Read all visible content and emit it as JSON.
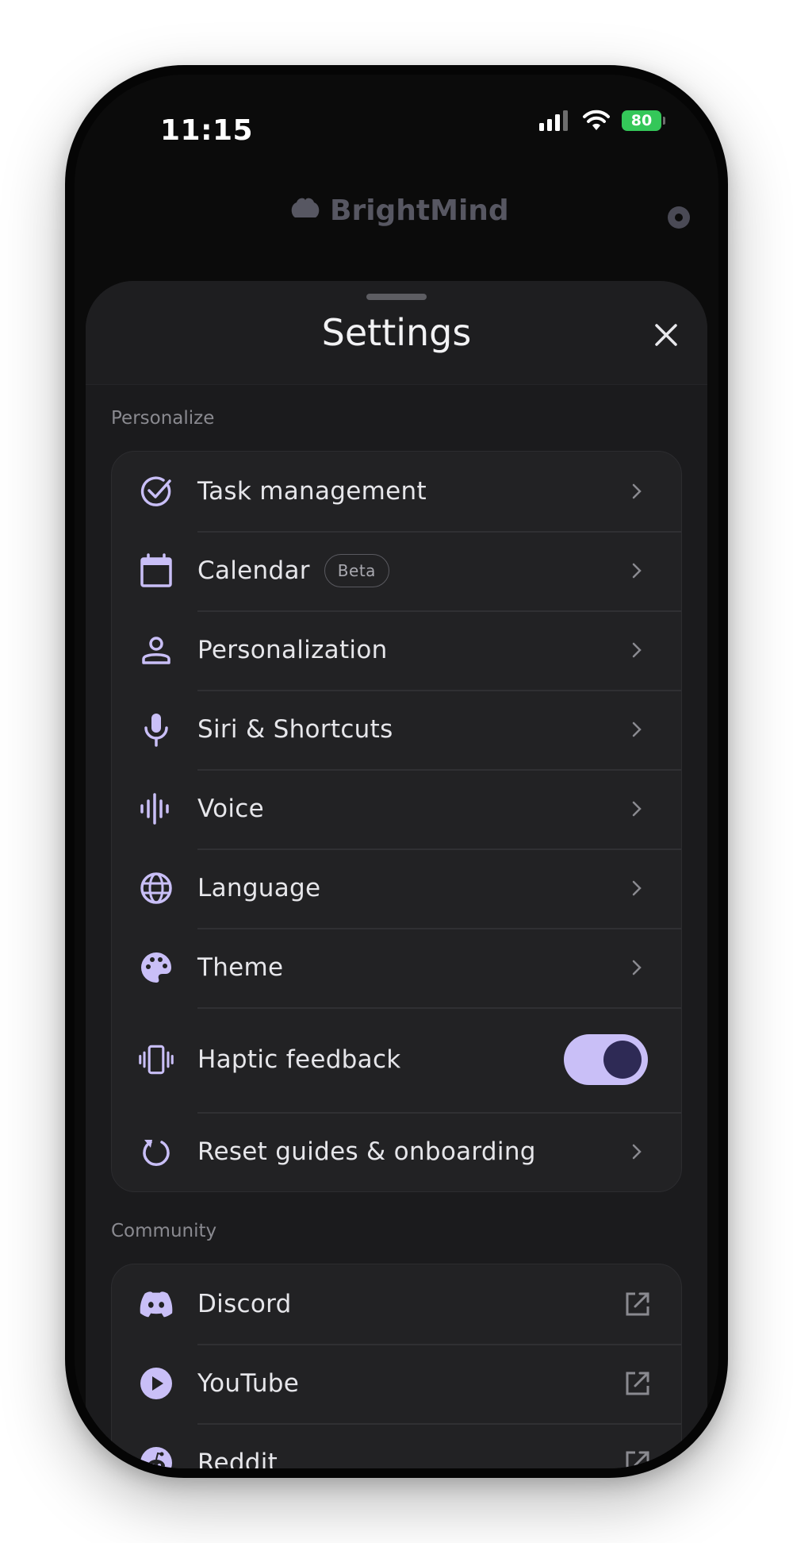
{
  "status_bar": {
    "time": "11:15",
    "battery_level": "80"
  },
  "behind": {
    "brand": "BrightMind"
  },
  "sheet": {
    "title": "Settings"
  },
  "accent_color": "#c9bff7",
  "personalize": {
    "label": "Personalize",
    "items": [
      {
        "label": "Task management",
        "icon": "check-circle-icon"
      },
      {
        "label": "Calendar",
        "badge": "Beta",
        "icon": "calendar-icon"
      },
      {
        "label": "Personalization",
        "icon": "person-icon"
      },
      {
        "label": "Siri & Shortcuts",
        "icon": "microphone-icon"
      },
      {
        "label": "Voice",
        "icon": "waveform-icon"
      },
      {
        "label": "Language",
        "icon": "globe-icon"
      },
      {
        "label": "Theme",
        "icon": "palette-icon"
      },
      {
        "label": "Haptic feedback",
        "icon": "vibration-icon",
        "toggle_on": true
      },
      {
        "label": "Reset guides & onboarding",
        "icon": "reset-icon"
      }
    ]
  },
  "community": {
    "label": "Community",
    "items": [
      {
        "label": "Discord",
        "icon": "discord-icon"
      },
      {
        "label": "YouTube",
        "icon": "play-icon"
      },
      {
        "label": "Reddit",
        "icon": "reddit-icon"
      }
    ]
  }
}
